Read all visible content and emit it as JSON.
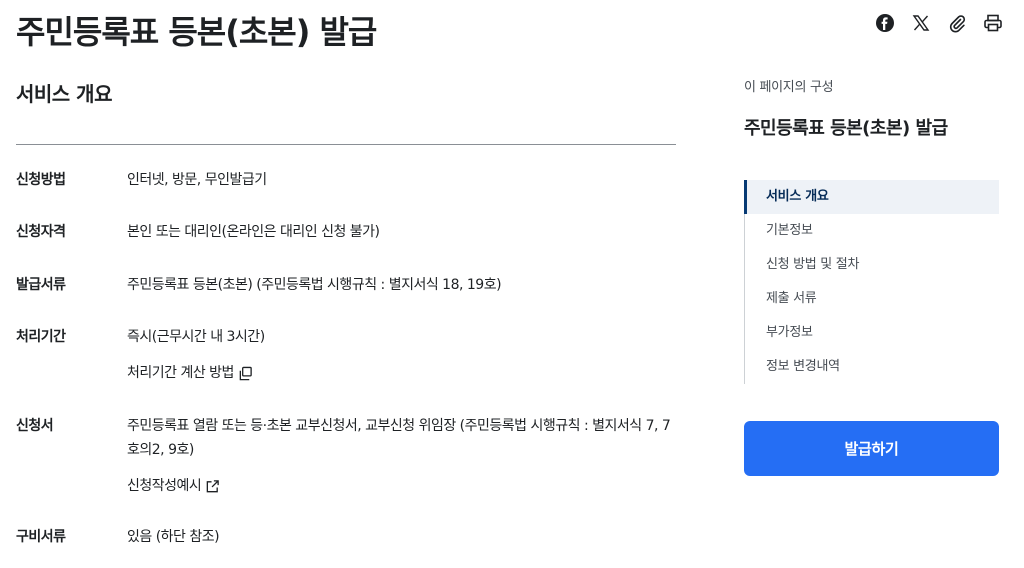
{
  "page": {
    "title": "주민등록표 등본(초본) 발급"
  },
  "share": {
    "icons": [
      "facebook-icon",
      "x-icon",
      "link-icon",
      "print-icon"
    ]
  },
  "overview": {
    "heading": "서비스 개요",
    "rows": [
      {
        "label": "신청방법",
        "value": "인터넷, 방문, 무인발급기"
      },
      {
        "label": "신청자격",
        "value": "본인 또는 대리인(온라인은 대리인 신청 불가)"
      },
      {
        "label": "발급서류",
        "value": "주민등록표 등본(초본) (주민등록법 시행규칙 : 별지서식 18, 19호)"
      },
      {
        "label": "처리기간",
        "value": "즉시(근무시간 내 3시간)",
        "link": "처리기간 계산 방법"
      },
      {
        "label": "신청서",
        "value": "주민등록표 열람 또는 등·초본 교부신청서, 교부신청 위임장 (주민등록법 시행규칙 : 별지서식 7, 7호의2, 9호)",
        "link": "신청작성예시"
      },
      {
        "label": "구비서류",
        "value": "있음 (하단 참조)"
      }
    ]
  },
  "toc": {
    "caption": "이 페이지의 구성",
    "title": "주민등록표 등본(초본) 발급",
    "items": [
      "서비스 개요",
      "기본정보",
      "신청 방법 및 절차",
      "제출 서류",
      "부가정보",
      "정보 변경내역"
    ],
    "active_index": 0
  },
  "action": {
    "issue_label": "발급하기"
  },
  "colors": {
    "primary": "#256ef4",
    "active_bar": "#063a74",
    "active_bg": "#eef2f7"
  }
}
